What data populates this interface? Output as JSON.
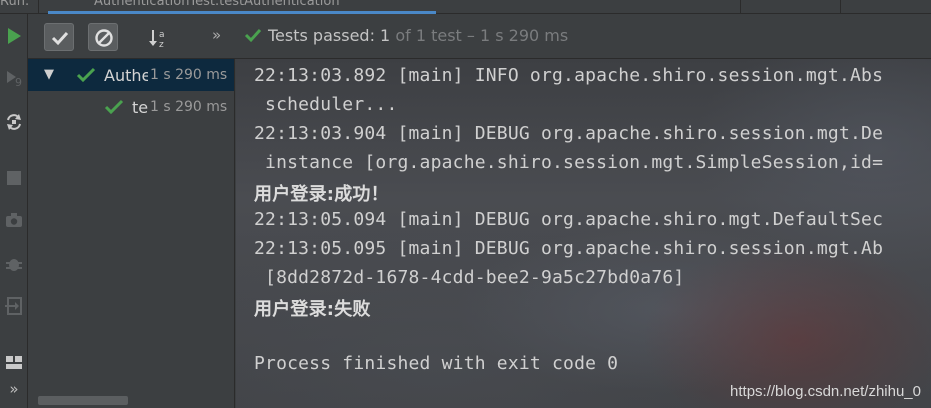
{
  "tabs": {
    "left_fragment": "Run:",
    "active_label": "AuthenticationTest.testAuthentication",
    "colors": {
      "accent": "#4a88c7"
    }
  },
  "left_toolbar": {
    "icons": [
      "rerun-icon",
      "rerun-failed-icon",
      "toggle-autotest-icon",
      "stop-icon",
      "camera-icon",
      "debug-icon",
      "exit-icon",
      "layout-icon",
      "more-icon"
    ],
    "more_label": "»"
  },
  "run_toolbar": {
    "more_label": "»",
    "status_prefix": "Tests passed: ",
    "status_count": "1",
    "status_detail": " of 1 test – 1 s 290 ms"
  },
  "tree": {
    "rows": [
      {
        "name": "Authe",
        "duration": "1 s 290 ms",
        "expanded": true
      },
      {
        "name": "te",
        "duration": "1 s 290 ms"
      }
    ]
  },
  "console": {
    "lines": [
      "22:13:03.892 [main] INFO org.apache.shiro.session.mgt.Abs",
      " scheduler...",
      "22:13:03.904 [main] DEBUG org.apache.shiro.session.mgt.De",
      " instance [org.apache.shiro.session.mgt.SimpleSession,id=",
      "用户登录:成功！",
      "22:13:05.094 [main] DEBUG org.apache.shiro.mgt.DefaultSec",
      "22:13:05.095 [main] DEBUG org.apache.shiro.session.mgt.Ab",
      " [8dd2872d-1678-4cdd-bee2-9a5c27bd0a76]",
      "用户登录:失败",
      "",
      "Process finished with exit code 0"
    ],
    "watermark": "https://blog.csdn.net/zhihu_0"
  }
}
